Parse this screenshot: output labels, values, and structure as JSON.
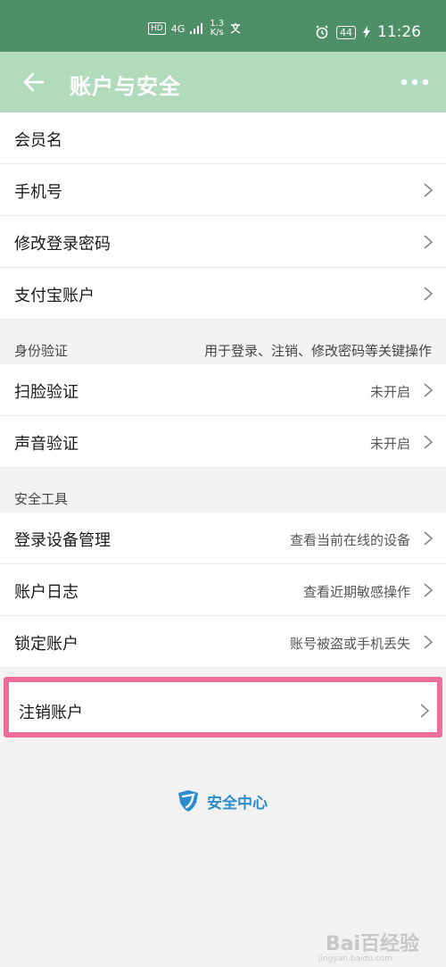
{
  "status_bar": {
    "hd": "HD",
    "network": "4G",
    "speed_value": "1.3",
    "speed_unit": "K/s",
    "battery": "44",
    "time": "11:26"
  },
  "header": {
    "title": "账户与安全"
  },
  "rows_top": [
    {
      "label": "会员名"
    },
    {
      "label": "手机号"
    },
    {
      "label": "修改登录密码"
    },
    {
      "label": "支付宝账户"
    }
  ],
  "identity_section": {
    "title": "身份验证",
    "note": "用于登录、注销、修改密码等关键操作",
    "rows": [
      {
        "label": "扫脸验证",
        "value": "未开启"
      },
      {
        "label": "声音验证",
        "value": "未开启"
      }
    ]
  },
  "tools_section": {
    "title": "安全工具",
    "rows": [
      {
        "label": "登录设备管理",
        "value": "查看当前在线的设备"
      },
      {
        "label": "账户日志",
        "value": "查看近期敏感操作"
      },
      {
        "label": "锁定账户",
        "value": "账号被盗或手机丢失"
      }
    ]
  },
  "cancel_account": {
    "label": "注销账户"
  },
  "security_center": {
    "label": "安全中心"
  },
  "watermark": {
    "text": "Bai百经验",
    "sub": "jingyan.baidu.com"
  },
  "colors": {
    "status_bar_bg": "#4e8f6a",
    "title_bar_bg": "#b2dbbd",
    "highlight_border": "#ec6f9b",
    "security_blue": "#2a8ccf"
  }
}
